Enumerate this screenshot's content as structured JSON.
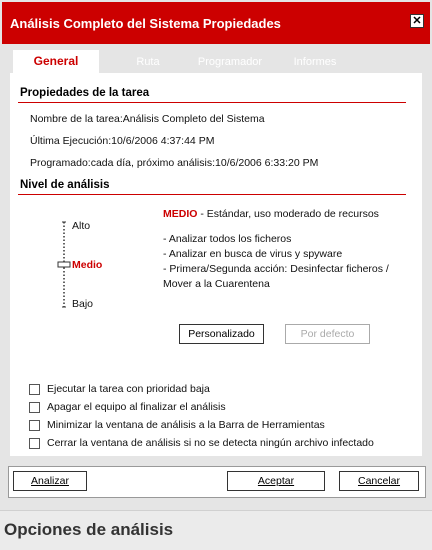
{
  "window": {
    "title": "Análisis Completo del Sistema Propiedades",
    "close_glyph": "✕"
  },
  "tabs": [
    {
      "label": "General",
      "active": true
    },
    {
      "label": "Ruta",
      "active": false
    },
    {
      "label": "Programador",
      "active": false
    },
    {
      "label": "Informes",
      "active": false
    }
  ],
  "task_props": {
    "title": "Propiedades de la tarea",
    "name": "Nombre de la tarea:Análisis Completo del Sistema",
    "last_run": "Última Ejecución:10/6/2006 4:37:44 PM",
    "scheduled": "Programado:cada día, próximo análisis:10/6/2006 6:33:20 PM"
  },
  "analysis_level": {
    "title": "Nivel de análisis",
    "levels": [
      "Alto",
      "Medio",
      "Bajo"
    ],
    "selected": "Medio",
    "desc_level": "MEDIO",
    "desc_text": " - Estándar, uso moderado de recursos",
    "bullets": [
      "- Analizar todos los ficheros",
      "- Analizar en busca de virus y spyware",
      "- Primera/Segunda acción: Desinfectar ficheros /",
      "Mover a la Cuarentena"
    ],
    "custom_button": "Personalizado",
    "default_button": "Por defecto"
  },
  "options": [
    {
      "label": "Ejecutar la tarea con prioridad baja",
      "checked": false
    },
    {
      "label": "Apagar el equipo al finalizar el análisis",
      "checked": false
    },
    {
      "label": "Minimizar la ventana de análisis a la Barra de Herramientas",
      "checked": false
    },
    {
      "label": "Cerrar la ventana de análisis si no se detecta ningún archivo infectado",
      "checked": false
    }
  ],
  "actions": {
    "analyze": "Analizar",
    "accept": "Aceptar",
    "cancel": "Cancelar"
  },
  "caption": "Opciones de análisis",
  "colors": {
    "accent": "#cc0000",
    "panel": "#ffffff",
    "frame": "#e5e5e5"
  }
}
